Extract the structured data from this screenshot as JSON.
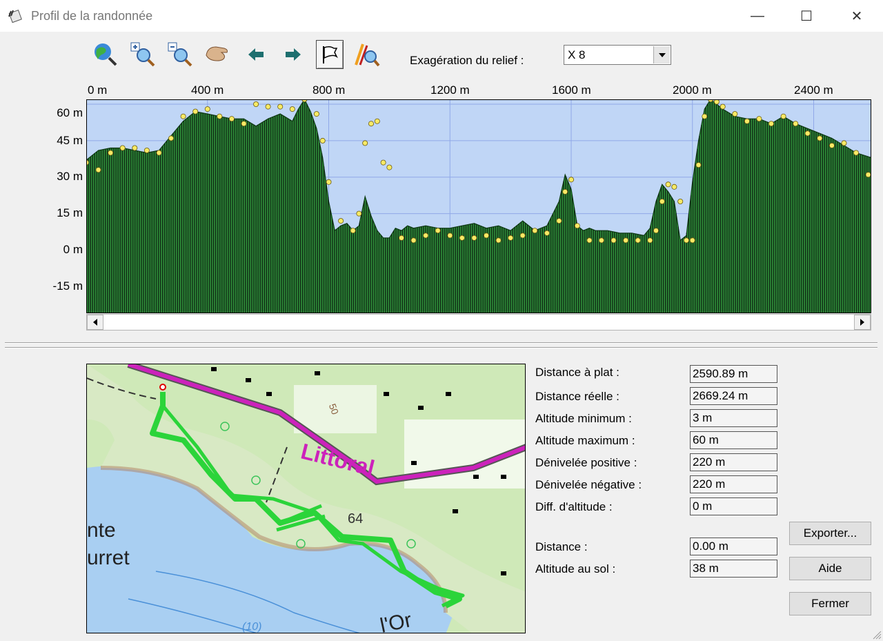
{
  "window": {
    "title": "Profil de la randonnée",
    "controls": {
      "minimize": "—",
      "maximize": "☐",
      "close": "✕"
    }
  },
  "toolbar": {
    "icons": [
      "zoom-extent-icon",
      "zoom-in-icon",
      "zoom-out-icon",
      "pan-hand-icon",
      "arrow-left-icon",
      "arrow-right-icon",
      "waypoint-flag-icon",
      "profile-search-icon"
    ],
    "relief_label": "Exagération du relief :",
    "relief_value": "X 8"
  },
  "chart_data": {
    "type": "area",
    "x_tick_labels": [
      "0 m",
      "400 m",
      "800 m",
      "1200 m",
      "1600 m",
      "2000 m",
      "2400 m"
    ],
    "y_tick_labels": [
      "60 m",
      "45 m",
      "30 m",
      "15 m",
      "0 m",
      "-15 m"
    ],
    "xlim": [
      0,
      2590
    ],
    "ylim": [
      -26,
      62
    ],
    "grid": true,
    "colors": {
      "fill": "#2f8f3a",
      "sky": "#c0d6f6",
      "grid": "#90a8e8",
      "points": "#f7ea66"
    },
    "x": [
      0,
      40,
      80,
      120,
      160,
      200,
      240,
      280,
      320,
      360,
      400,
      440,
      480,
      520,
      560,
      600,
      640,
      680,
      700,
      720,
      740,
      760,
      780,
      800,
      820,
      840,
      860,
      880,
      900,
      920,
      940,
      960,
      980,
      1000,
      1020,
      1040,
      1060,
      1080,
      1120,
      1160,
      1200,
      1240,
      1280,
      1320,
      1360,
      1400,
      1440,
      1480,
      1520,
      1560,
      1580,
      1600,
      1620,
      1640,
      1660,
      1680,
      1720,
      1760,
      1800,
      1840,
      1860,
      1880,
      1900,
      1920,
      1940,
      1960,
      1980,
      2000,
      2020,
      2040,
      2060,
      2080,
      2100,
      2140,
      2180,
      2220,
      2260,
      2300,
      2340,
      2380,
      2420,
      2460,
      2500,
      2540,
      2590
    ],
    "y": [
      37,
      41,
      42,
      42,
      41,
      40,
      41,
      47,
      53,
      57,
      56,
      55,
      54,
      54,
      51,
      54,
      56,
      53,
      58,
      62,
      57,
      50,
      38,
      20,
      8,
      10,
      11,
      8,
      10,
      22,
      14,
      8,
      5,
      5,
      9,
      8,
      10,
      9,
      10,
      9,
      9,
      10,
      11,
      9,
      10,
      8,
      12,
      8,
      10,
      20,
      31,
      25,
      10,
      8,
      9,
      8,
      8,
      7,
      7,
      6,
      9,
      20,
      27,
      24,
      20,
      4,
      6,
      28,
      45,
      58,
      62,
      60,
      58,
      55,
      54,
      54,
      52,
      55,
      52,
      50,
      48,
      46,
      43,
      40,
      38
    ],
    "gps_points_x": [
      0,
      40,
      80,
      120,
      160,
      200,
      240,
      280,
      320,
      360,
      400,
      440,
      480,
      520,
      560,
      600,
      640,
      680,
      720,
      760,
      780,
      800,
      840,
      880,
      900,
      920,
      940,
      960,
      980,
      1000,
      1040,
      1080,
      1120,
      1160,
      1200,
      1240,
      1280,
      1320,
      1360,
      1400,
      1440,
      1480,
      1520,
      1560,
      1580,
      1600,
      1620,
      1660,
      1700,
      1740,
      1780,
      1820,
      1860,
      1880,
      1900,
      1920,
      1940,
      1960,
      1980,
      2000,
      2020,
      2040,
      2060,
      2080,
      2100,
      2140,
      2180,
      2220,
      2260,
      2300,
      2340,
      2380,
      2420,
      2460,
      2500,
      2540,
      2580
    ],
    "gps_points_y": [
      36,
      33,
      40,
      42,
      42,
      41,
      40,
      46,
      55,
      57,
      58,
      55,
      54,
      52,
      60,
      59,
      59,
      58,
      62,
      56,
      45,
      28,
      12,
      8,
      15,
      44,
      52,
      53,
      36,
      34,
      5,
      4,
      6,
      8,
      6,
      5,
      5,
      6,
      4,
      5,
      6,
      8,
      7,
      12,
      24,
      29,
      10,
      4,
      4,
      4,
      4,
      4,
      4,
      8,
      20,
      27,
      26,
      20,
      4,
      4,
      35,
      55,
      62,
      61,
      59,
      56,
      53,
      54,
      52,
      55,
      52,
      48,
      46,
      43,
      44,
      40,
      31
    ]
  },
  "map": {
    "labels": [
      "Littoral",
      "64",
      "50",
      "nte",
      "urret",
      "l'Or",
      "(10)"
    ]
  },
  "stats": [
    {
      "label": "Distance à plat :",
      "value": "2590.89 m"
    },
    {
      "label": "Distance réelle :",
      "value": "2669.24 m"
    },
    {
      "label": "Altitude minimum :",
      "value": "3 m"
    },
    {
      "label": "Altitude maximum :",
      "value": "60 m"
    },
    {
      "label": "Dénivelée positive :",
      "value": "220 m"
    },
    {
      "label": "Dénivelée négative :",
      "value": "220 m"
    },
    {
      "label": "Diff. d'altitude :",
      "value": "0 m"
    },
    {
      "label": "Distance :",
      "value": "0.00 m"
    },
    {
      "label": "Altitude au sol :",
      "value": "38 m"
    }
  ],
  "buttons": {
    "export": "Exporter...",
    "help": "Aide",
    "close": "Fermer"
  }
}
